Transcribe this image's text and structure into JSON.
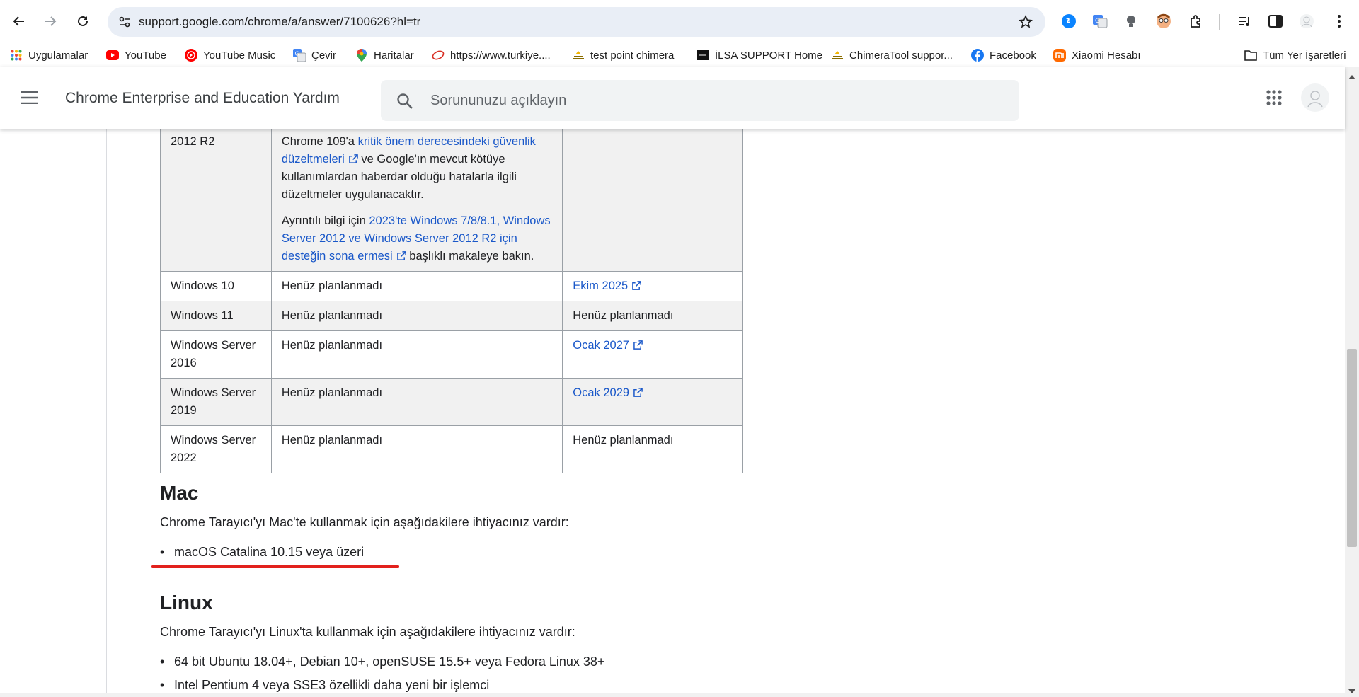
{
  "browser": {
    "url": "support.google.com/chrome/a/answer/7100626?hl=tr",
    "bookmarks": [
      {
        "label": "Uygulamalar",
        "icon": "apps-grid-icon"
      },
      {
        "label": "YouTube",
        "icon": "youtube-icon"
      },
      {
        "label": "YouTube Music",
        "icon": "youtube-music-icon"
      },
      {
        "label": "Çevir",
        "icon": "google-translate-icon"
      },
      {
        "label": "Haritalar",
        "icon": "google-maps-icon"
      },
      {
        "label": "https://www.turkiye....",
        "icon": "turkiye-icon"
      },
      {
        "label": "test point chimera",
        "icon": "chimera-icon"
      },
      {
        "label": "İLSA SUPPORT Home",
        "icon": "ilsa-icon"
      },
      {
        "label": "ChimeraTool suppor...",
        "icon": "chimera-icon"
      },
      {
        "label": "Facebook",
        "icon": "facebook-icon"
      },
      {
        "label": "Xiaomi Hesabı",
        "icon": "xiaomi-icon"
      }
    ],
    "all_bookmarks_label": "Tüm Yer İşaretleri"
  },
  "header": {
    "title": "Chrome Enterprise and Education Yardım",
    "search_placeholder": "Sorununuzu açıklayın"
  },
  "table": {
    "partial_row": {
      "os": "2012 R2",
      "text1_prefix": "Chrome 109'a ",
      "text1_link": "kritik önem derecesindeki güvenlik düzeltmeleri",
      "text1_suffix": " ve Google'ın mevcut kötüye kullanımlardan haberdar olduğu hatalarla ilgili düzeltmeler uygulanacaktır.",
      "text2_prefix": "Ayrıntılı bilgi için ",
      "text2_link": "2023'te Windows 7/8/8.1, Windows Server 2012 ve Windows Server 2012 R2 için desteğin sona ermesi",
      "text2_suffix": " başlıklı makaleye bakın."
    },
    "rows": [
      {
        "os": "Windows 10",
        "chrome": "Henüz planlanmadı",
        "eos": "Ekim 2025",
        "eos_link": true
      },
      {
        "os": "Windows 11",
        "chrome": "Henüz planlanmadı",
        "eos": "Henüz planlanmadı",
        "eos_link": false
      },
      {
        "os": "Windows Server 2016",
        "chrome": "Henüz planlanmadı",
        "eos": "Ocak 2027",
        "eos_link": true
      },
      {
        "os": "Windows Server 2019",
        "chrome": "Henüz planlanmadı",
        "eos": "Ocak 2029",
        "eos_link": true
      },
      {
        "os": "Windows Server 2022",
        "chrome": "Henüz planlanmadı",
        "eos": "Henüz planlanmadı",
        "eos_link": false
      }
    ]
  },
  "mac": {
    "heading": "Mac",
    "intro": "Chrome Tarayıcı'yı Mac'te kullanmak için aşağıdakilere ihtiyacınız vardır:",
    "items": [
      "macOS Catalina 10.15 veya üzeri"
    ]
  },
  "linux": {
    "heading": "Linux",
    "intro": "Chrome Tarayıcı'yı Linux'ta kullanmak için aşağıdakilere ihtiyacınız vardır:",
    "items": [
      "64 bit Ubuntu 18.04+, Debian 10+, openSUSE 15.5+ veya Fedora Linux 38+",
      "Intel Pentium 4 veya SSE3 özellikli daha yeni bir işlemci"
    ]
  },
  "colors": {
    "link": "#1a58c9",
    "annotation_underline": "#e2211c",
    "table_shade": "#f1f1f1"
  }
}
